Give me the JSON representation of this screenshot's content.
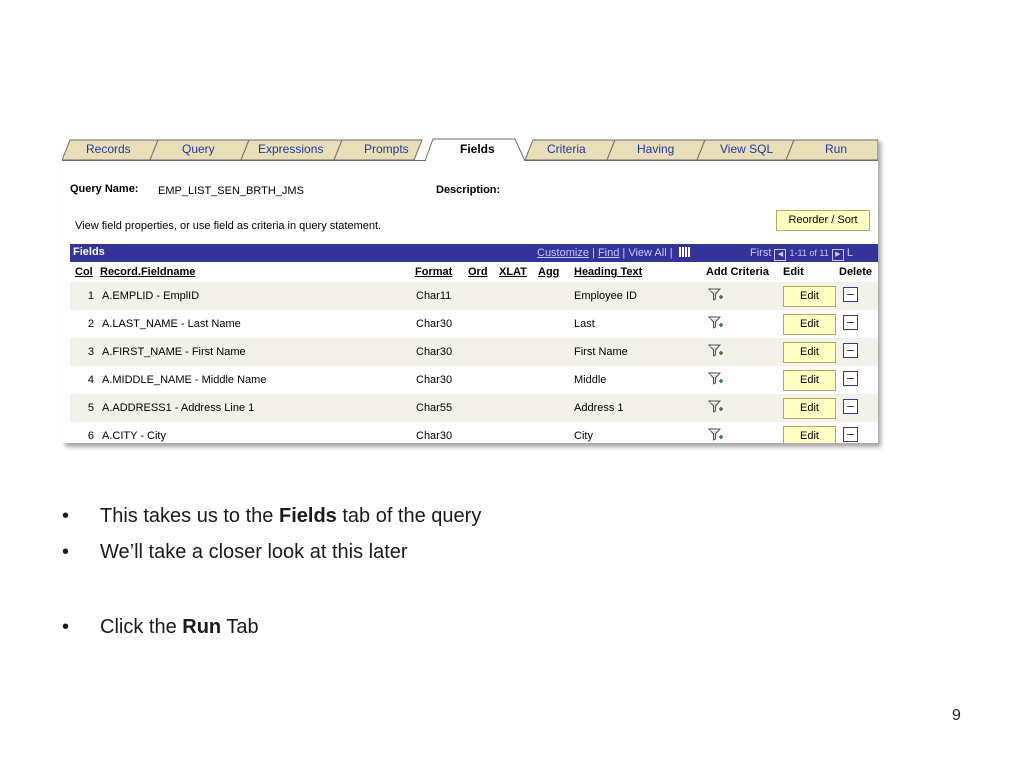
{
  "tabs": [
    "Records",
    "Query",
    "Expressions",
    "Prompts",
    "Fields",
    "Criteria",
    "Having",
    "View SQL",
    "Run"
  ],
  "active_tab": "Fields",
  "query_name_label": "Query Name:",
  "query_name_value": "EMP_LIST_SEN_BRTH_JMS",
  "description_label": "Description:",
  "info_text": "View field properties, or use field as criteria in query statement.",
  "reorder_label": "Reorder / Sort",
  "fields_grid": {
    "title": "Fields",
    "customize": "Customize",
    "find": "Find",
    "view_all": "View All",
    "first": "First",
    "range": "1-11 of 11",
    "last": "L",
    "columns": {
      "col": "Col",
      "record_fieldname": "Record.Fieldname",
      "format": "Format",
      "ord": "Ord",
      "xlat": "XLAT",
      "agg": "Agg",
      "heading_text": "Heading Text",
      "add_criteria": "Add Criteria",
      "edit": "Edit",
      "delete": "Delete"
    },
    "edit_label": "Edit",
    "rows": [
      {
        "col": "1",
        "field": "A.EMPLID - EmplID",
        "format": "Char11",
        "heading": "Employee ID"
      },
      {
        "col": "2",
        "field": "A.LAST_NAME - Last Name",
        "format": "Char30",
        "heading": "Last"
      },
      {
        "col": "3",
        "field": "A.FIRST_NAME - First Name",
        "format": "Char30",
        "heading": "First Name"
      },
      {
        "col": "4",
        "field": "A.MIDDLE_NAME - Middle Name",
        "format": "Char30",
        "heading": "Middle"
      },
      {
        "col": "5",
        "field": "A.ADDRESS1 - Address Line 1",
        "format": "Char55",
        "heading": "Address 1"
      },
      {
        "col": "6",
        "field": "A.CITY - City",
        "format": "Char30",
        "heading": "City"
      }
    ]
  },
  "slide": {
    "bullet_char": "•",
    "b1_pre": "This takes us to the ",
    "b1_bold": "Fields",
    "b1_post": " tab of the query",
    "b2": "We’ll take a closer look at this later",
    "b3_pre": "Click the ",
    "b3_bold": "Run",
    "b3_post": " Tab",
    "page_number": "9"
  },
  "colors": {
    "grid_header": "#333399",
    "tab_fill": "#e8dfb9",
    "button_fill": "#ffffc4",
    "link_blue": "#1f3a9a"
  },
  "icons": [
    "filter-add-icon",
    "minus-icon",
    "grid-icon",
    "prev-icon",
    "next-icon"
  ]
}
